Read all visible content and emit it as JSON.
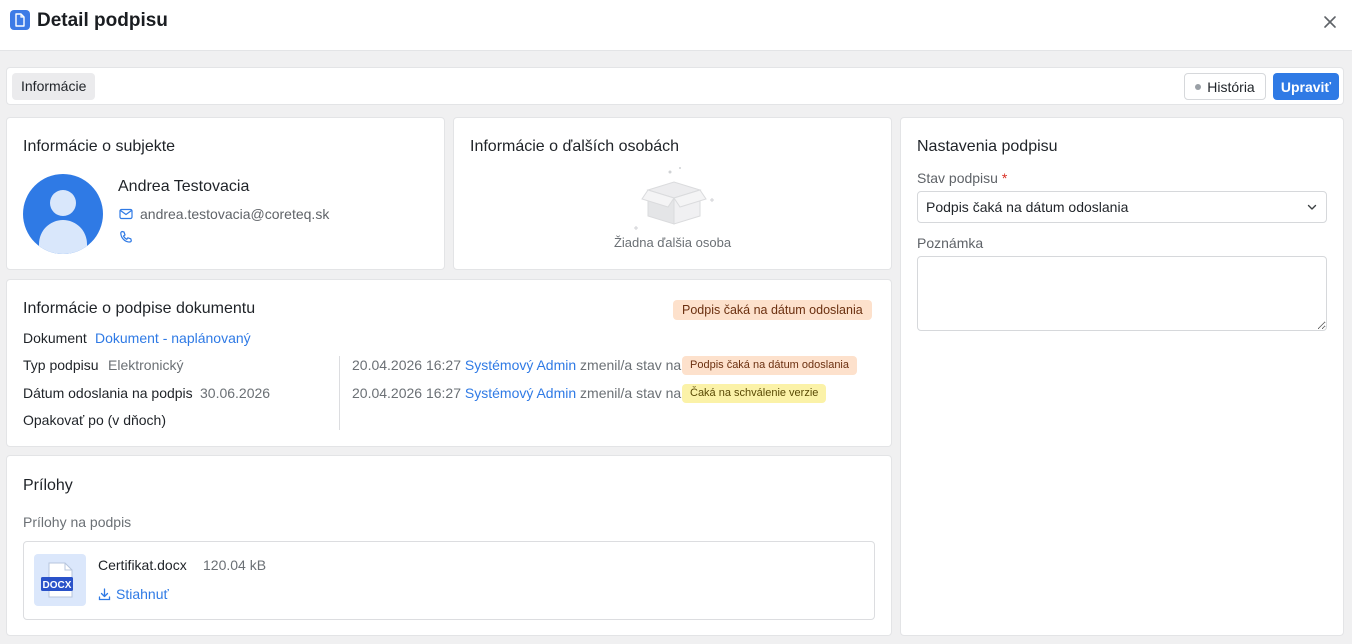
{
  "header": {
    "title": "Detail podpisu",
    "close_icon": "close-icon",
    "doc_icon": "document-icon"
  },
  "tabbar": {
    "tab_label": "Informácie",
    "history_label": "História",
    "edit_label": "Upraviť"
  },
  "subject": {
    "title": "Informácie o subjekte",
    "name": "Andrea Testovacia",
    "email": "andrea.testovacia@coreteq.sk"
  },
  "others": {
    "title": "Informácie o ďalších osobách",
    "empty_text": "Žiadna ďalšia osoba"
  },
  "signature_info": {
    "title": "Informácie o podpise dokumentu",
    "status_badge": "Podpis čaká na dátum odoslania",
    "document_label": "Dokument",
    "document_value": "Dokument - naplánovaný",
    "type_label": "Typ podpisu",
    "type_value": "Elektronický",
    "send_date_label": "Dátum odoslania na podpis",
    "send_date_value": "30.06.2026",
    "repeat_label": "Opakovať po (v dňoch)",
    "history": [
      {
        "timestamp": "20.04.2026 16:27",
        "user": "Systémový Admin",
        "action": "zmenil/a stav na",
        "status": "Podpis čaká na dátum odoslania"
      },
      {
        "timestamp": "20.04.2026 16:27",
        "user": "Systémový Admin",
        "action": "zmenil/a stav na",
        "status": "Čaká na schválenie verzie"
      }
    ]
  },
  "attachments": {
    "title": "Prílohy",
    "subtitle": "Prílohy na podpis",
    "file": {
      "name": "Certifikat.docx",
      "size": "120.04 kB",
      "type_label": "DOCX",
      "download_label": "Stiahnuť"
    }
  },
  "settings": {
    "title": "Nastavenia podpisu",
    "status_label": "Stav podpisu",
    "required_mark": "*",
    "status_value": "Podpis čaká na dátum odoslania",
    "note_label": "Poznámka",
    "note_value": ""
  },
  "colors": {
    "accent": "#2f7ae5",
    "badge_orange": "#fde1cc",
    "badge_yellow": "#fbf2a8"
  }
}
